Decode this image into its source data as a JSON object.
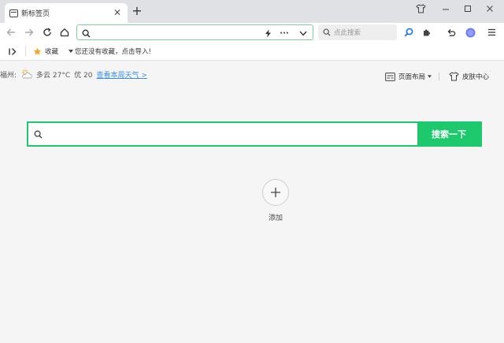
{
  "tab": {
    "title": "新标签页"
  },
  "toolbar": {
    "address_value": "",
    "side_search_placeholder": "点此搜索"
  },
  "bookmarks": {
    "favorites_label": "收藏",
    "empty_hint": "您还没有收藏，点击导入!"
  },
  "weather": {
    "city": "福州:",
    "condition": "多云 27°C",
    "air_quality": "优 20",
    "link_text": "查看本周天气 >"
  },
  "page_actions": {
    "layout_label": "页面布局",
    "skin_label": "皮肤中心"
  },
  "search": {
    "button_label": "搜索一下",
    "value": ""
  },
  "shortcuts": {
    "add_label": "添加"
  },
  "colors": {
    "accent": "#1ec96d",
    "link": "#3a8ee6"
  }
}
